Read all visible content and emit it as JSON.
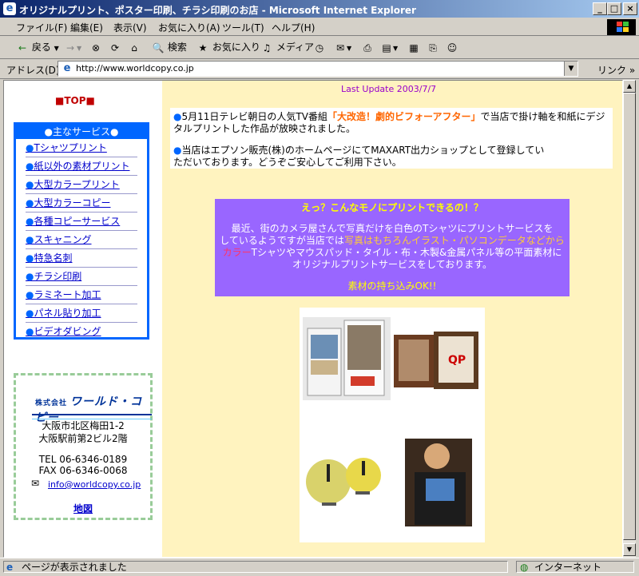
{
  "window": {
    "title": "オリジナルプリント、ポスター印刷、チラシ印刷のお店 - Microsoft Internet Explorer",
    "controls": [
      "_",
      "□",
      "×"
    ]
  },
  "menu": [
    "ファイル(F)",
    "編集(E)",
    "表示(V)",
    "お気に入り(A)",
    "ツール(T)",
    "ヘルプ(H)"
  ],
  "toolbar": {
    "back": "戻る",
    "search": "検索",
    "favorites": "お気に入り",
    "media": "メディア"
  },
  "address": {
    "label": "アドレス(D)",
    "url": "http://www.worldcopy.co.jp",
    "links": "リンク"
  },
  "sidebar": {
    "top_link": "■TOP■",
    "services_heading": "●主なサービス●",
    "services": [
      "Tシャツプリント",
      "紙以外の素材プリント",
      "大型カラープリント",
      "大型カラーコピー",
      "各種コピーサービス",
      "スキャニング",
      "特急名刺",
      "チラシ印刷",
      "ラミネート加工",
      "パネル貼り加工",
      "ビデオダビング"
    ],
    "company": {
      "logo_prefix": "株式会社",
      "logo_name": "ワールド・コピー",
      "address1": "大阪市北区梅田1-2",
      "address2": "大阪駅前第2ビル2階",
      "tel": "TEL 06-6346-0189",
      "fax": "FAX 06-6346-0068",
      "email": "info@worldcopy.co.jp",
      "map": "地図"
    }
  },
  "main": {
    "last_update": "Last Update 2003/7/7",
    "news1_a": "5月11日テレビ朝日の人気TV番組",
    "news1_highlight": "「大改造！劇的ビフォーアフター」",
    "news1_b": "で当店で掛け軸を和紙にデジタルプリントした作品が放映されました。",
    "news2": "当店はエプソン販売(株)のホームページにてMAXART出力ショップとして登録していただいております。どうぞご安心してご利用下さい。",
    "promo_title": "えっ？こんなモノにプリントできるの！？",
    "promo_line1": "最近、街のカメラ屋さんで写真だけを白色のTシャツにプリントサービスを",
    "promo_line2a": "しているようですが当店では",
    "promo_line2b": "写真はもちろんイラスト・パソコンデータなどから",
    "promo_line3a": "カラー",
    "promo_line3b": "Tシャツやマウスパッド・タイル・布・木製&金属パネル等の平面素材に",
    "promo_line4": "オリジナルプリントサービスをしております。",
    "promo_footer": "素材の持ち込みOK!!"
  },
  "status": {
    "text": "ページが表示されました",
    "zone": "インターネット"
  }
}
